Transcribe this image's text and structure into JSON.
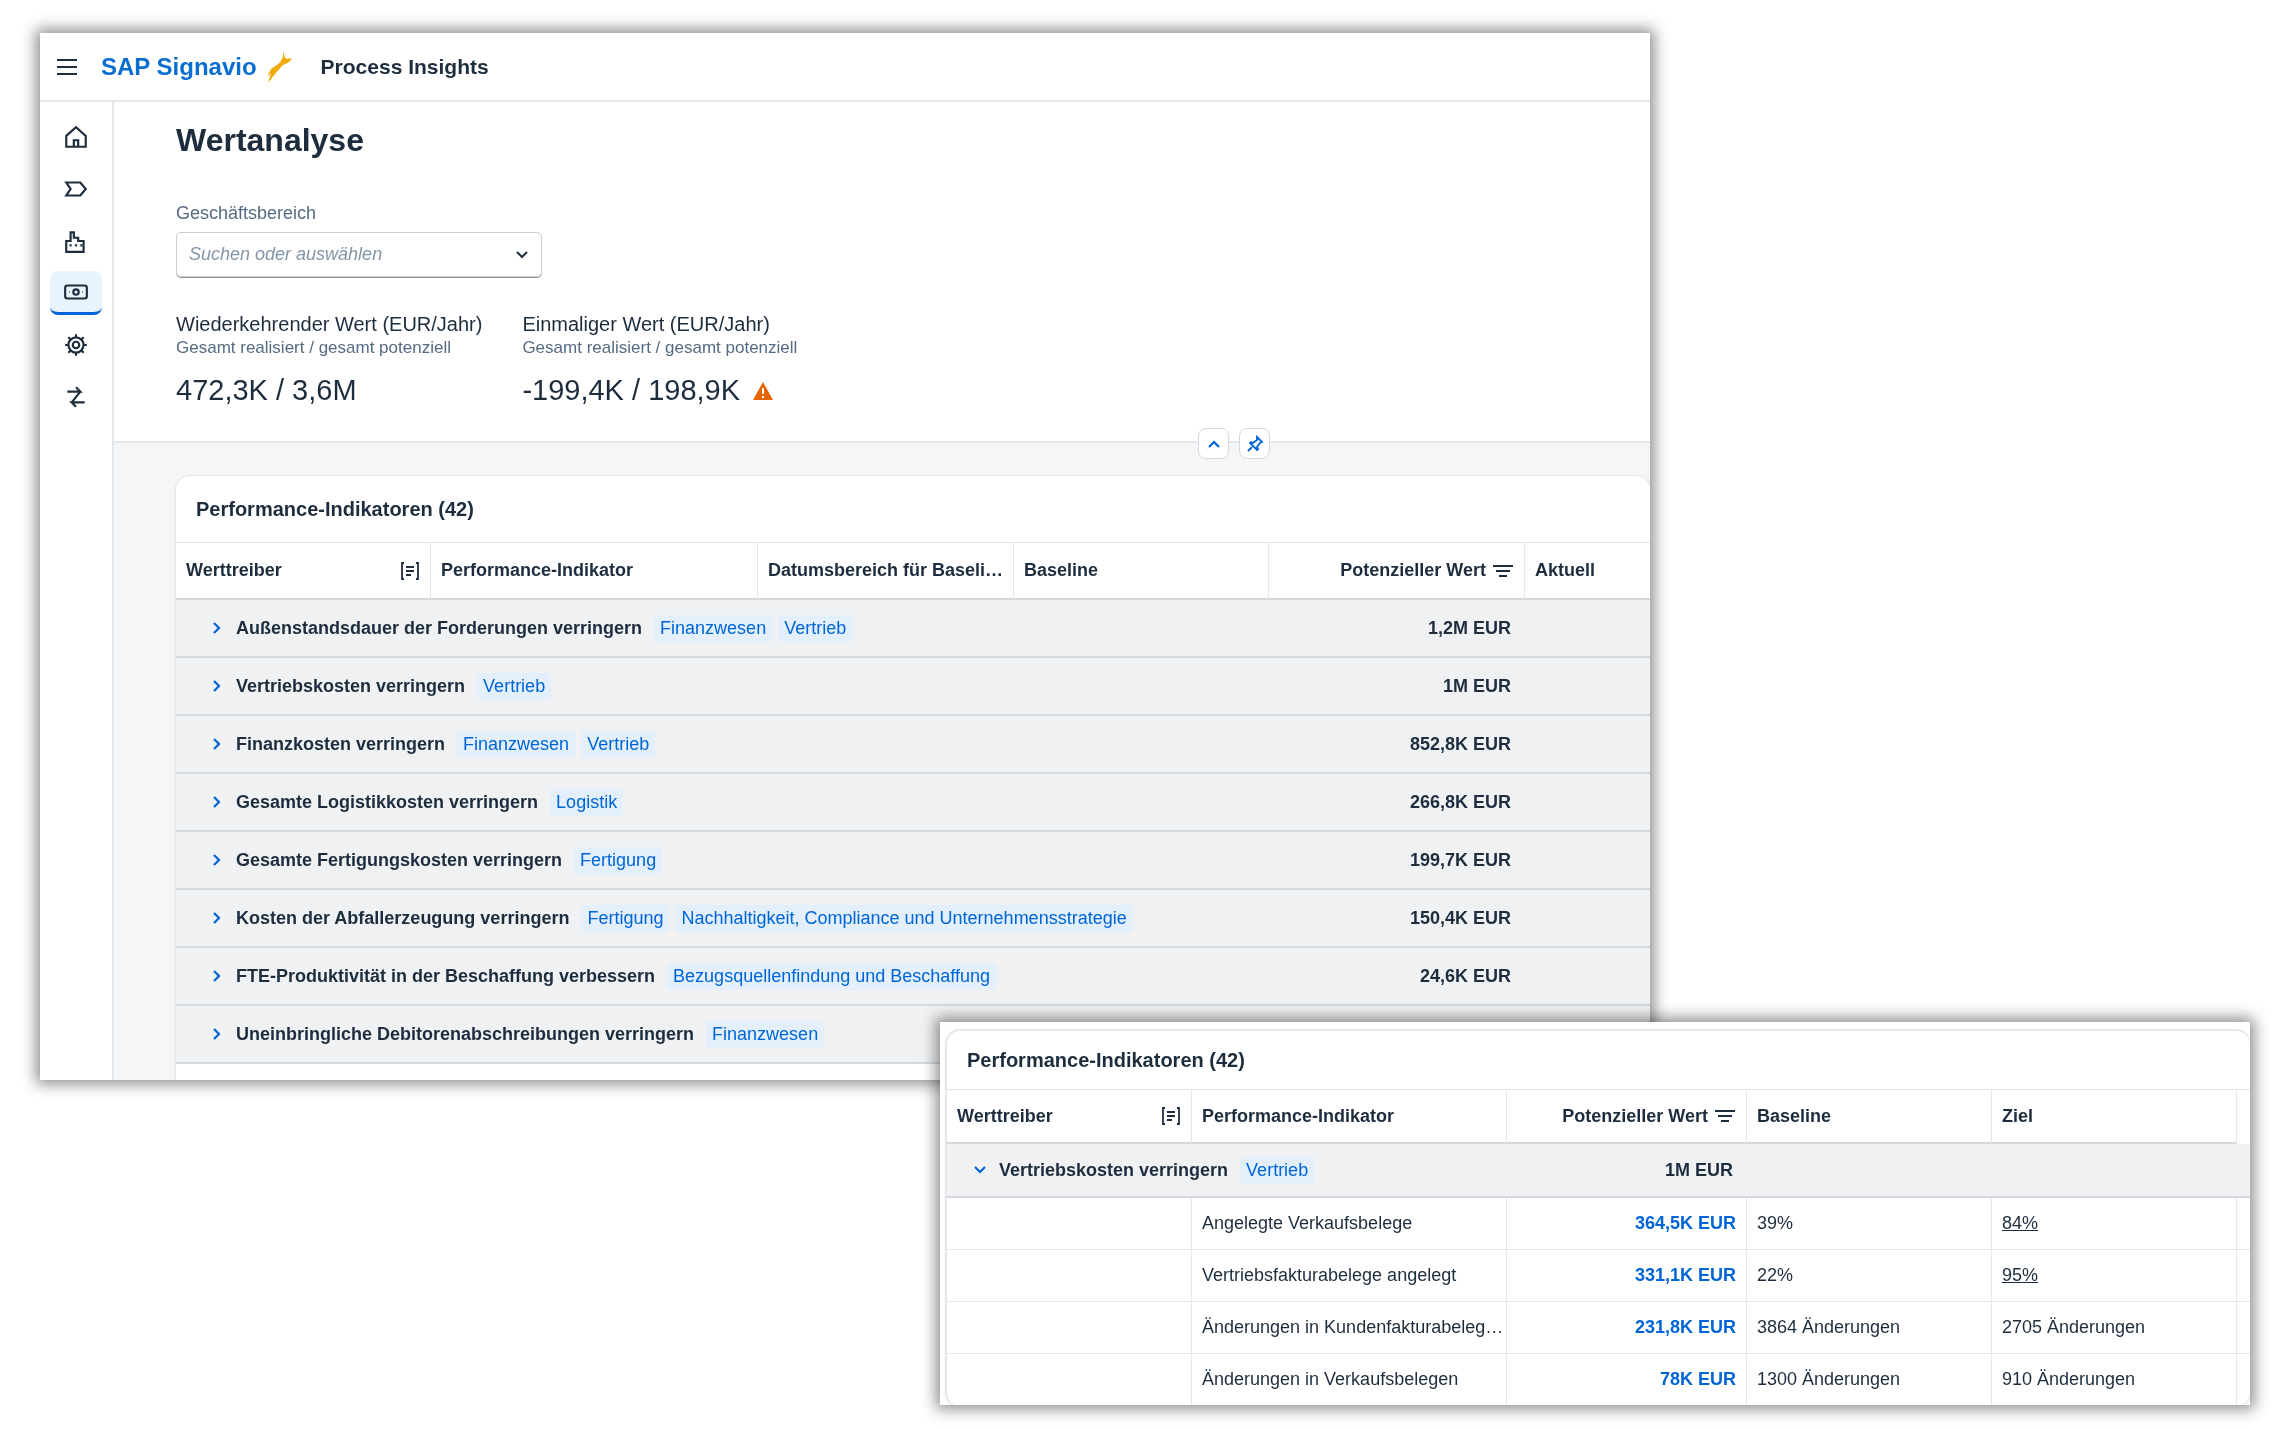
{
  "app": {
    "brand": "SAP Signavio",
    "product": "Process Insights"
  },
  "sidebar": {
    "items": [
      {
        "selected": false
      },
      {
        "selected": false
      },
      {
        "selected": false
      },
      {
        "selected": true
      },
      {
        "selected": false
      },
      {
        "selected": false
      }
    ]
  },
  "page": {
    "title": "Wertanalyse",
    "filter": {
      "label": "Geschäftsbereich",
      "placeholder": "Suchen oder auswählen"
    }
  },
  "kpis": [
    {
      "title": "Wiederkehrender Wert (EUR/Jahr)",
      "subtitle": "Gesamt realisiert / gesamt potenziell",
      "value": "472,3K / 3,6M",
      "warning": false
    },
    {
      "title": "Einmaliger Wert (EUR/Jahr)",
      "subtitle": "Gesamt realisiert / gesamt potenziell",
      "value": "-199,4K / 198,9K",
      "warning": true
    }
  ],
  "main_table": {
    "title": "Performance-Indikatoren (42)",
    "columns": [
      {
        "label": "Werttreiber",
        "kind": "menu"
      },
      {
        "label": "Performance-Indikator",
        "kind": "plain"
      },
      {
        "label": "Datumsbereich für Baseli…",
        "kind": "plain"
      },
      {
        "label": "Baseline",
        "kind": "plain"
      },
      {
        "label": "Potenzieller Wert",
        "kind": "sort"
      },
      {
        "label": "Aktuell",
        "kind": "plain"
      }
    ],
    "rows": [
      {
        "name": "Außenstandsdauer der Forderungen verringern",
        "tags": [
          "Finanzwesen",
          "Vertrieb"
        ],
        "potential": "1,2M EUR",
        "expanded": false
      },
      {
        "name": "Vertriebskosten verringern",
        "tags": [
          "Vertrieb"
        ],
        "potential": "1M EUR",
        "expanded": false
      },
      {
        "name": "Finanzkosten verringern",
        "tags": [
          "Finanzwesen",
          "Vertrieb"
        ],
        "potential": "852,8K EUR",
        "expanded": false
      },
      {
        "name": "Gesamte Logistikkosten verringern",
        "tags": [
          "Logistik"
        ],
        "potential": "266,8K EUR",
        "expanded": false
      },
      {
        "name": "Gesamte Fertigungskosten verringern",
        "tags": [
          "Fertigung"
        ],
        "potential": "199,7K EUR",
        "expanded": false
      },
      {
        "name": "Kosten der Abfallerzeugung verringern",
        "tags": [
          "Fertigung",
          "Nachhaltigkeit, Compliance und Unternehmensstrategie"
        ],
        "potential": "150,4K EUR",
        "expanded": false
      },
      {
        "name": "FTE-Produktivität in der Beschaffung verbessern",
        "tags": [
          "Bezugsquellenfindung und Beschaffung"
        ],
        "potential": "24,6K EUR",
        "expanded": false
      },
      {
        "name": "Uneinbringliche Debitorenabschreibungen verringern",
        "tags": [
          "Finanzwesen"
        ],
        "expanded": false
      }
    ]
  },
  "detail_table": {
    "title": "Performance-Indikatoren (42)",
    "columns": [
      {
        "label": "Werttreiber",
        "kind": "menu"
      },
      {
        "label": "Performance-Indikator",
        "kind": "plain"
      },
      {
        "label": "Potenzieller Wert",
        "kind": "sort"
      },
      {
        "label": "Baseline",
        "kind": "plain"
      },
      {
        "label": "Ziel",
        "kind": "plain"
      }
    ],
    "group": {
      "name": "Vertriebskosten verringern",
      "tags": [
        "Vertrieb"
      ],
      "potential": "1M EUR",
      "expanded": true
    },
    "rows": [
      {
        "indicator": "Angelegte Verkaufsbelege",
        "potential": "364,5K EUR",
        "baseline": "39%",
        "target": "84%",
        "target_link": true
      },
      {
        "indicator": "Vertriebsfakturabelege angelegt",
        "potential": "331,1K EUR",
        "baseline": "22%",
        "target": "95%",
        "target_link": true
      },
      {
        "indicator": "Änderungen in Kundenfakturabeleg…",
        "potential": "231,8K EUR",
        "baseline": "3864 Änderungen",
        "target": "2705 Änderungen",
        "target_link": false
      },
      {
        "indicator": "Änderungen in Verkaufsbelegen",
        "potential": "78K EUR",
        "baseline": "1300 Änderungen",
        "target": "910 Änderungen",
        "target_link": false
      }
    ]
  }
}
